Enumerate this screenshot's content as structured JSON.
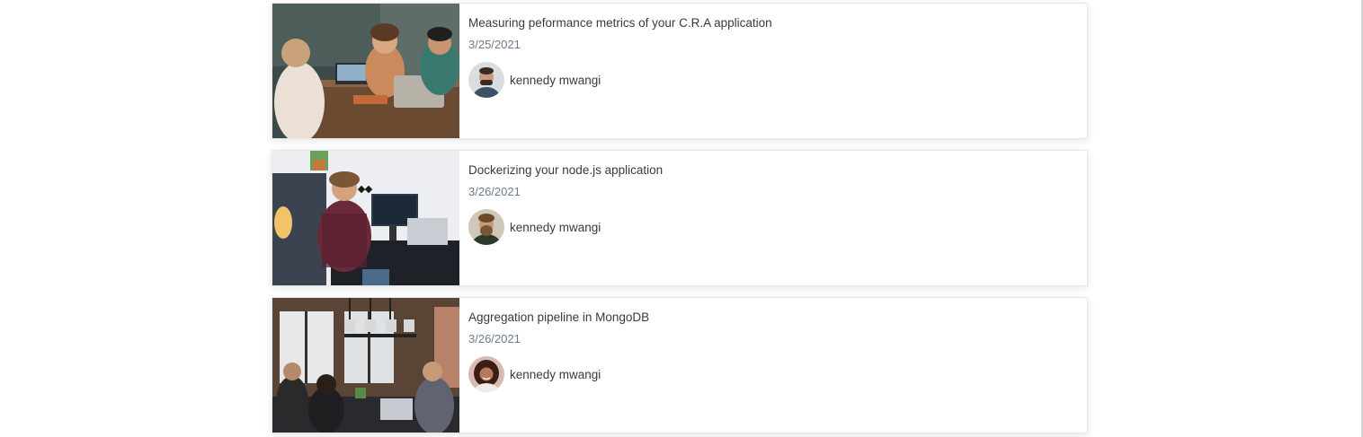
{
  "posts": [
    {
      "title": "Measuring peformance metrics of your C.R.A application",
      "date": "3/25/2021",
      "author": "kennedy mwangi",
      "thumbnail_icon": "team-laptop-photo",
      "avatar_icon": "man-portrait-avatar"
    },
    {
      "title": "Dockerizing your node.js application",
      "date": "3/26/2021",
      "author": "kennedy mwangi",
      "thumbnail_icon": "developer-desk-photo",
      "avatar_icon": "bearded-man-avatar"
    },
    {
      "title": "Aggregation pipeline in MongoDB",
      "date": "3/26/2021",
      "author": "kennedy mwangi",
      "thumbnail_icon": "office-meeting-photo",
      "avatar_icon": "curly-hair-woman-avatar"
    }
  ]
}
